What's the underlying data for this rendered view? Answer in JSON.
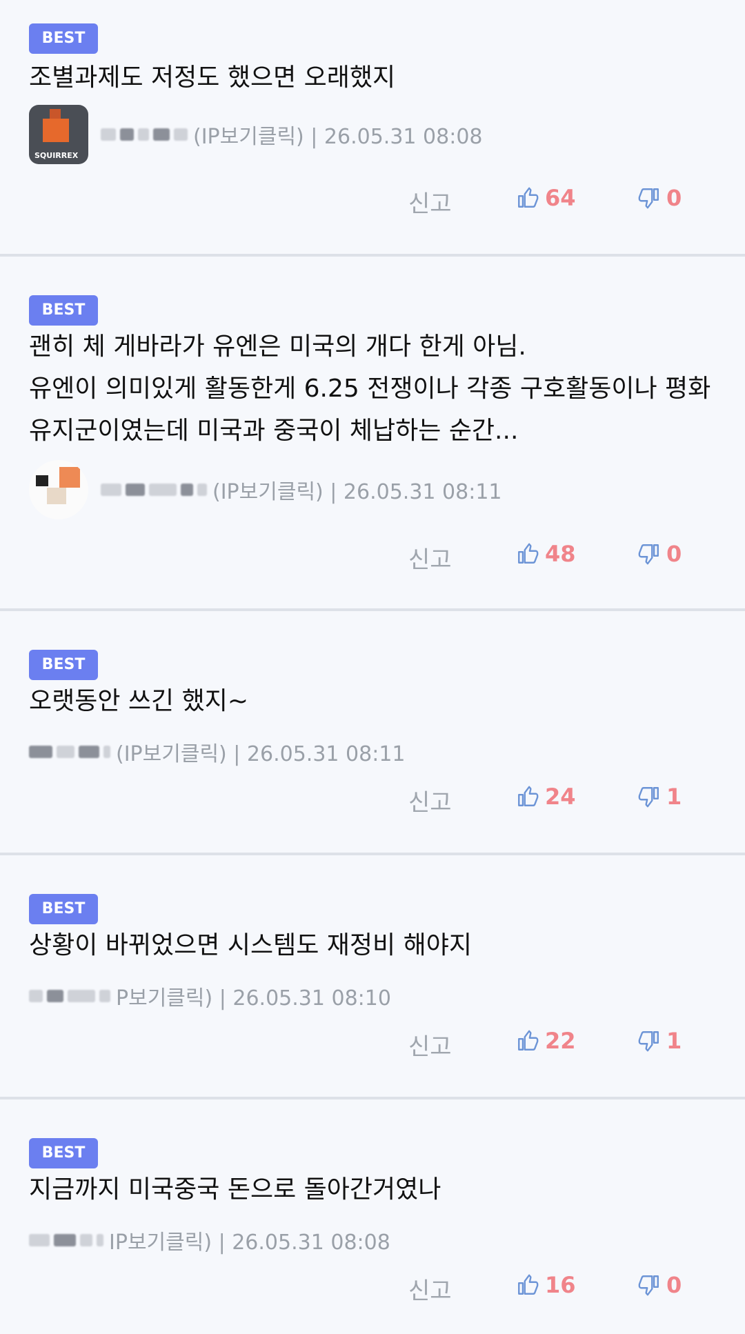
{
  "colors": {
    "badge_bg": "#6b7ff0",
    "thumb_icon": "#6c94d6",
    "count": "#f0848a",
    "meta_text": "#9aa0a8",
    "divider": "#dde1e8",
    "background": "#f6f8fc"
  },
  "icons": {
    "like": "thumbs-up-icon",
    "dislike": "thumbs-down-icon"
  },
  "comments": [
    {
      "badge": "BEST",
      "text": "조별과제도 저정도 했으면 오래했지",
      "meta": "(IP보기클릭) | 26.05.31 08:08",
      "report": "신고",
      "likes": "64",
      "dislikes": "0"
    },
    {
      "badge": "BEST",
      "text": "괜히 체 게바라가 유엔은 미국의 개다 한게 아님.\n유엔이 의미있게 활동한게 6.25 전쟁이나 각종 구호활동이나 평화유지군이였는데 미국과 중국이 체납하는 순간...",
      "meta": "(IP보기클릭) | 26.05.31 08:11",
      "report": "신고",
      "likes": "48",
      "dislikes": "0"
    },
    {
      "badge": "BEST",
      "text": "오랫동안 쓰긴 했지~",
      "meta": "(IP보기클릭) | 26.05.31 08:11",
      "report": "신고",
      "likes": "24",
      "dislikes": "1"
    },
    {
      "badge": "BEST",
      "text": "상황이 바뀌었으면 시스템도 재정비 해야지",
      "meta": "P보기클릭) | 26.05.31 08:10",
      "report": "신고",
      "likes": "22",
      "dislikes": "1"
    },
    {
      "badge": "BEST",
      "text": "지금까지 미국중국 돈으로 돌아간거였나",
      "meta": "IP보기클릭) | 26.05.31 08:08",
      "report": "신고",
      "likes": "16",
      "dislikes": "0"
    }
  ]
}
